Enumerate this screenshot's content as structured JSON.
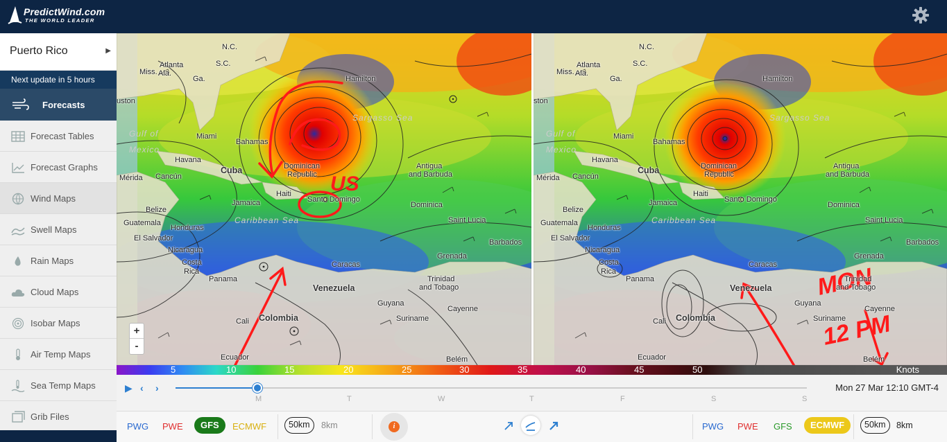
{
  "header": {
    "brand": "PredictWind.com",
    "tagline": "THE WORLD LEADER"
  },
  "sidebar": {
    "location": "Puerto Rico",
    "update_notice": "Next update in 5 hours",
    "active": "Forecasts",
    "items": [
      {
        "label": "Forecast Tables",
        "icon": "table-icon"
      },
      {
        "label": "Forecast Graphs",
        "icon": "graph-icon"
      },
      {
        "label": "Wind Maps",
        "icon": "globe-icon"
      },
      {
        "label": "Swell Maps",
        "icon": "wave-icon"
      },
      {
        "label": "Rain Maps",
        "icon": "raindrop-icon"
      },
      {
        "label": "Cloud Maps",
        "icon": "cloud-icon"
      },
      {
        "label": "Isobar Maps",
        "icon": "isobar-icon"
      },
      {
        "label": "Air Temp Maps",
        "icon": "thermometer-icon"
      },
      {
        "label": "Sea Temp Maps",
        "icon": "sea-temp-icon"
      },
      {
        "label": "Grib Files",
        "icon": "grib-icon"
      }
    ]
  },
  "map_left": {
    "labels": {
      "atlanta": "Atlanta",
      "ga": "Ga.",
      "sc": "S.C.",
      "nc": "N.C.",
      "hamilton": "Hamilton",
      "miss": "Miss.",
      "ala": "Ala.",
      "houston": "uston",
      "gulf1": "Gulf of",
      "gulf2": "Mexico",
      "miami": "Miami",
      "bahamas": "Bahamas",
      "sargasso": "Sargasso Sea",
      "havana": "Havana",
      "cuba": "Cuba",
      "cancun": "Cancún",
      "merida": "Mérida",
      "dominican1": "Dominican",
      "dominican2": "Republic",
      "antigua1": "Antigua",
      "antigua2": "and Barbuda",
      "haiti": "Haiti",
      "santo": "Santo Domingo",
      "jamaica": "Jamaica",
      "dominica": "Dominica",
      "belize": "Belize",
      "saintlucia": "Saint Lucia",
      "guatemala": "Guatemala",
      "honduras": "Honduras",
      "caribbean": "Caribbean Sea",
      "barbados": "Barbados",
      "elsalvador": "El Salvador",
      "nicaragua": "Nicaragua",
      "grenada": "Grenada",
      "costa1": "Costa",
      "costa2": "Rica",
      "caracas": "Caracas",
      "panama": "Panama",
      "trinidad1": "Trinidad",
      "trinidad2": "and Tobago",
      "venezuela": "Venezuela",
      "guyana": "Guyana",
      "cayenne": "Cayenne",
      "suriname": "Suriname",
      "cali": "Cali",
      "colombia": "Colombia",
      "ecuador": "Ecuador",
      "belem": "Belém"
    }
  },
  "map_right": {
    "labels": {
      "atlanta": "Atlanta",
      "ga": "Ga.",
      "sc": "S.C.",
      "nc": "N.C.",
      "hamilton": "Hamilton",
      "miss": "Miss.",
      "ala": "Ala.",
      "houston": "ston",
      "gulf1": "Gulf of",
      "gulf2": "Mexico",
      "miami": "Miami",
      "bahamas": "Bahamas",
      "sargasso": "Sargasso Sea",
      "havana": "Havana",
      "cuba": "Cuba",
      "cancun": "Cancún",
      "merida": "Mérida",
      "dominican1": "Dominican",
      "dominican2": "Republic",
      "antigua1": "Antigua",
      "antigua2": "and Barbuda",
      "haiti": "Haiti",
      "santo": "Santo Domingo",
      "jamaica": "Jamaica",
      "dominica": "Dominica",
      "belize": "Belize",
      "saintlucia": "Saint Lucia",
      "guatemala": "Guatemala",
      "honduras": "Honduras",
      "caribbean": "Caribbean Sea",
      "barbados": "Barbados",
      "elsalvador": "El Salvador",
      "nicaragua": "Nicaragua",
      "grenada": "Grenada",
      "costa1": "Costa",
      "costa2": "Rica",
      "caracas": "Caracas",
      "panama": "Panama",
      "trinidad1": "Trinidad",
      "trinidad2": "and Tobago",
      "venezuela": "Venezuela",
      "guyana": "Guyana",
      "cayenne": "Cayenne",
      "suriname": "Suriname",
      "cali": "Cali",
      "colombia": "Colombia",
      "ecuador": "Ecuador",
      "belem": "Belém"
    }
  },
  "annotations": {
    "left_note": "US",
    "right_note_1": "MON",
    "right_note_2": "12 PM"
  },
  "scale": {
    "ticks": [
      "5",
      "10",
      "15",
      "20",
      "25",
      "30",
      "35",
      "40",
      "45",
      "50"
    ],
    "unit": "Knots"
  },
  "timeline": {
    "days": [
      "M",
      "T",
      "W",
      "T",
      "F",
      "S",
      "S"
    ],
    "datetime": "Mon 27 Mar 12:10 GMT-4",
    "progress_fraction": 0.13
  },
  "models_left": {
    "pwg": "PWG",
    "pwe": "PWE",
    "gfs": "GFS",
    "ecmwf": "ECMWF",
    "selected": "GFS"
  },
  "models_right": {
    "pwg": "PWG",
    "pwe": "PWE",
    "gfs": "GFS",
    "ecmwf": "ECMWF",
    "selected": "ECMWF"
  },
  "resolution_left": {
    "selected": "50km",
    "other": "8km"
  },
  "resolution_right": {
    "selected": "50km",
    "other": "8km"
  },
  "colors": {
    "navy": "#0d2544",
    "accent": "#2d7fd0",
    "pwg": "#2a6ad0",
    "pwe": "#e03030",
    "gfs_pill": "#1a7a1a",
    "gfs_text": "#2a9a2a",
    "ecmwf_pill": "#ecc81a",
    "ecmwf_text": "#d8b010",
    "annotation": "#ff1a1a"
  }
}
